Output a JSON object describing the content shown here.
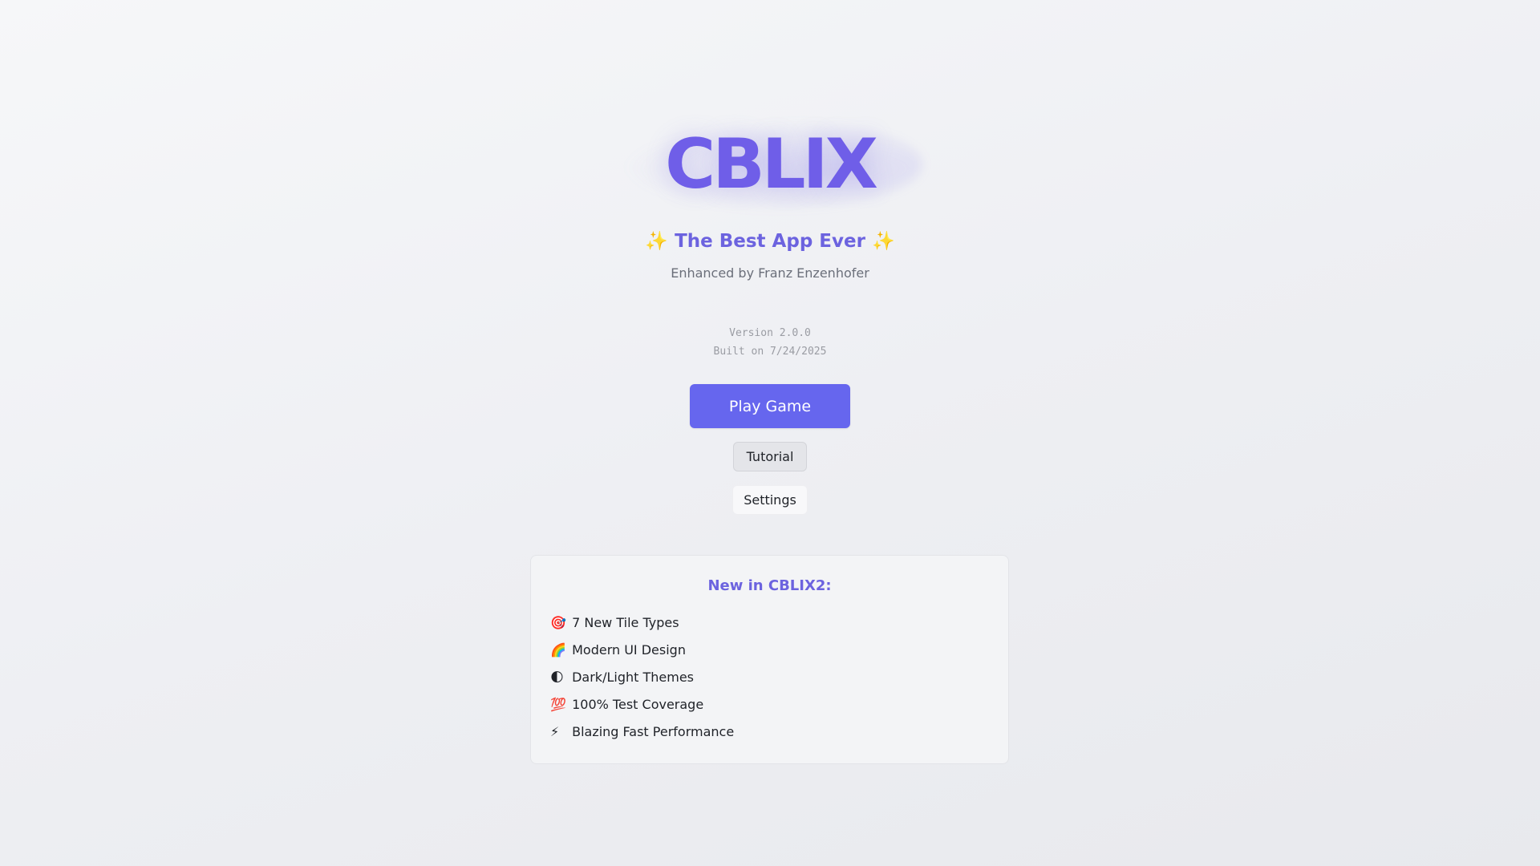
{
  "app": {
    "logo": "CBLIX",
    "tagline_sparkle_left": "✨",
    "tagline": "The Best App Ever",
    "tagline_sparkle_right": "✨",
    "author": "Enhanced by Franz Enzenhofer"
  },
  "build": {
    "version": "Version 2.0.0",
    "built_on": "Built on 7/24/2025"
  },
  "menu": {
    "play_label": "Play Game",
    "tutorial_label": "Tutorial",
    "settings_label": "Settings"
  },
  "features": {
    "title": "New in CBLIX2:",
    "items": [
      {
        "icon": "🎯",
        "label": "7 New Tile Types"
      },
      {
        "icon": "🌈",
        "label": "Modern UI Design"
      },
      {
        "icon": "🌓",
        "label": "Dark/Light Themes"
      },
      {
        "icon": "💯",
        "label": "100% Test Coverage"
      },
      {
        "icon": "⚡",
        "label": "Blazing Fast Performance"
      }
    ]
  },
  "colors": {
    "accent": "#6f5ee8",
    "primary_button": "#6666ee",
    "sparkle": "#f4c430"
  }
}
